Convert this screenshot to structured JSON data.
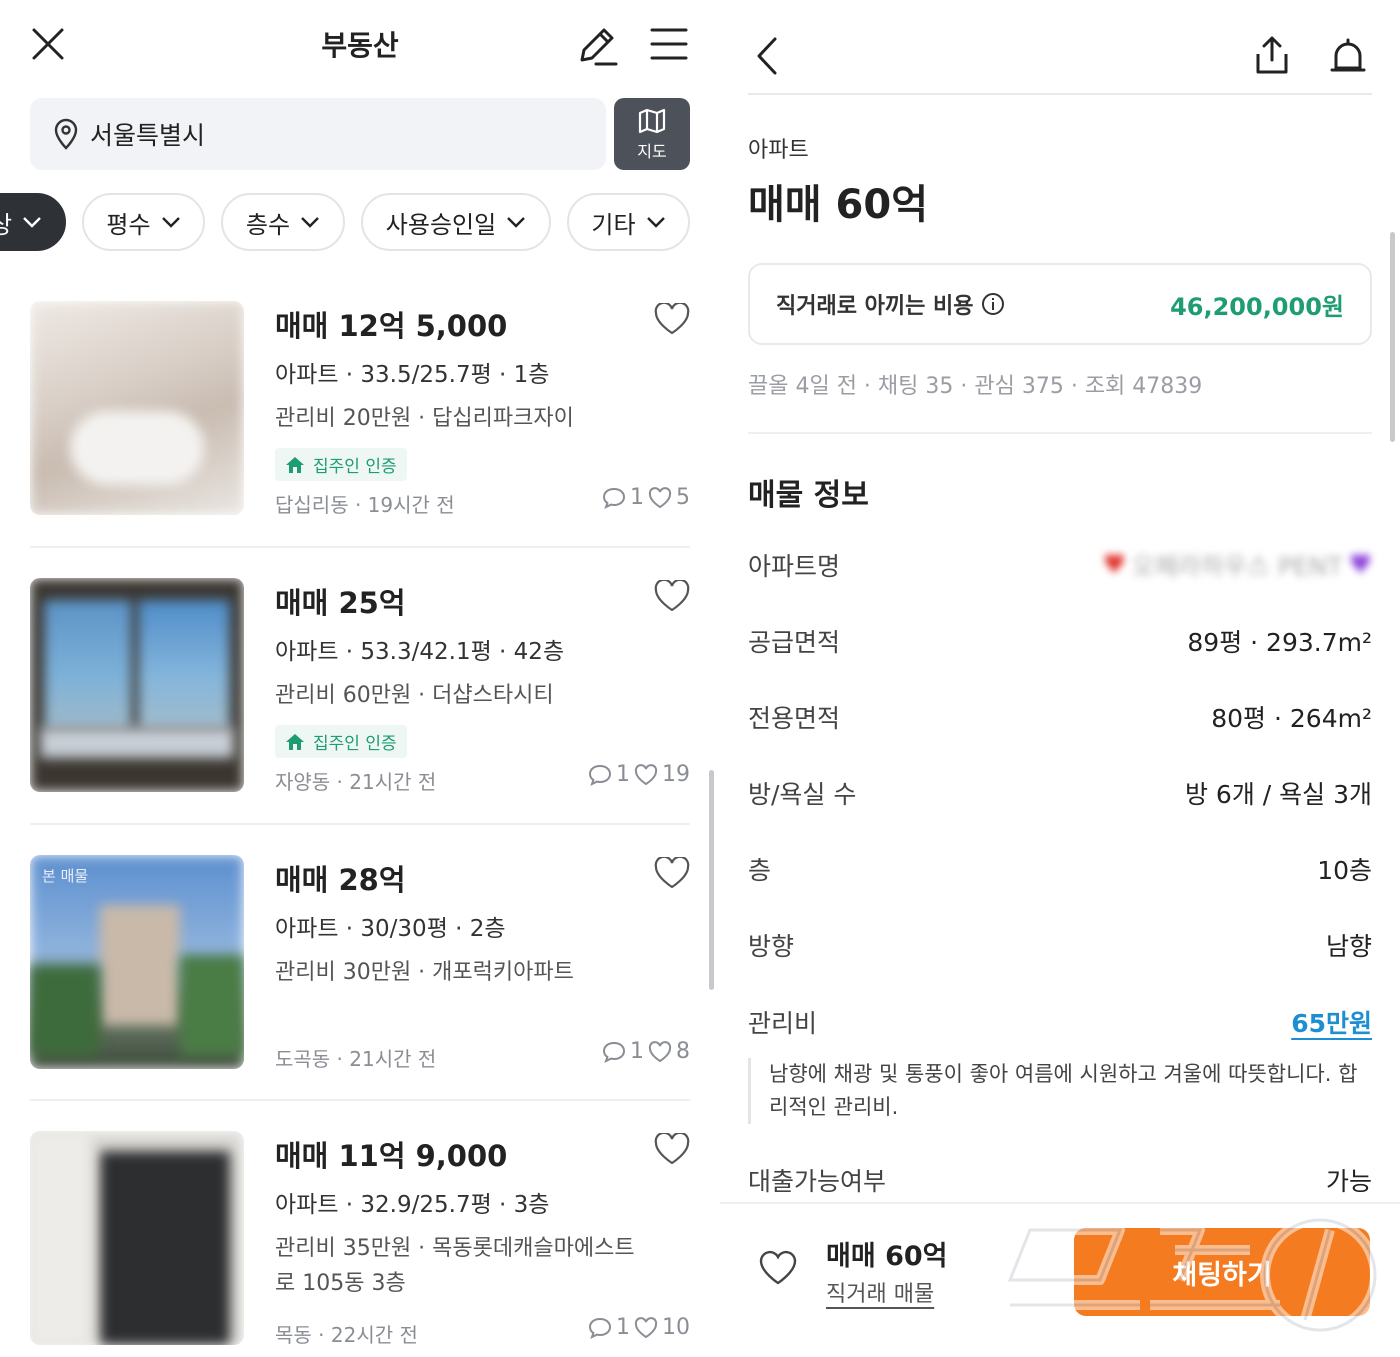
{
  "left": {
    "title": "부동산",
    "search": {
      "value": "서울특별시"
    },
    "map_button": "지도",
    "filters": [
      "상",
      "평수",
      "층수",
      "사용승인일",
      "기타"
    ],
    "listings": [
      {
        "price": "매매 12억 5,000",
        "spec": "아파트 · 33.5/25.7평 · 1층",
        "desc": "관리비 20만원 · 답십리파크자이",
        "badge": "집주인 인증",
        "meta": "답십리동 · 19시간 전",
        "comments": "1",
        "likes": "5"
      },
      {
        "price": "매매 25억",
        "spec": "아파트 · 53.3/42.1평 · 42층",
        "desc": "관리비 60만원 · 더샵스타시티",
        "badge": "집주인 인증",
        "meta": "자양동 · 21시간 전",
        "comments": "1",
        "likes": "19"
      },
      {
        "price": "매매 28억",
        "spec": "아파트 · 30/30평 · 2층",
        "desc": "관리비 30만원 · 개포럭키아파트",
        "badge": "",
        "meta": "도곡동 · 21시간 전",
        "comments": "1",
        "likes": "8",
        "thumb_label": "본 매물"
      },
      {
        "price": "매매 11억 9,000",
        "spec": "아파트 · 32.9/25.7평 · 3층",
        "desc": "관리비 35만원 · 목동롯데캐슬마에스트로 105동 3층",
        "badge": "",
        "meta": "목동 · 22시간 전",
        "comments": "1",
        "likes": "10"
      }
    ]
  },
  "right": {
    "type": "아파트",
    "price": "매매 60억",
    "savings": {
      "label": "직거래로 아끼는 비용",
      "value": "46,200,000원"
    },
    "stats": "끌올 4일 전 · 채팅 35 · 관심 375 · 조회 47839",
    "section_title": "매물 정보",
    "rows": [
      {
        "k": "아파트명",
        "v": "오페라하우스 PENT"
      },
      {
        "k": "공급면적",
        "v": "89평 · 293.7m²"
      },
      {
        "k": "전용면적",
        "v": "80평 · 264m²"
      },
      {
        "k": "방/욕실 수",
        "v": "방 6개 / 욕실 3개"
      },
      {
        "k": "층",
        "v": "10층"
      },
      {
        "k": "방향",
        "v": "남향"
      },
      {
        "k": "관리비",
        "v": "65만원"
      }
    ],
    "note": "남향에 채광 및 통풍이 좋아 여름에 시원하고 겨울에 따뜻합니다. 합리적인 관리비.",
    "loan": {
      "k": "대출가능여부",
      "v": "가능"
    },
    "bottom": {
      "price": "매매 60억",
      "sub": "직거래 매물",
      "chat": "채팅하기"
    },
    "colors": {
      "accent_green": "#1e9c73",
      "link_blue": "#1d8ed1",
      "chat_orange": "#f47b20"
    }
  },
  "watermark": "뉴스1"
}
